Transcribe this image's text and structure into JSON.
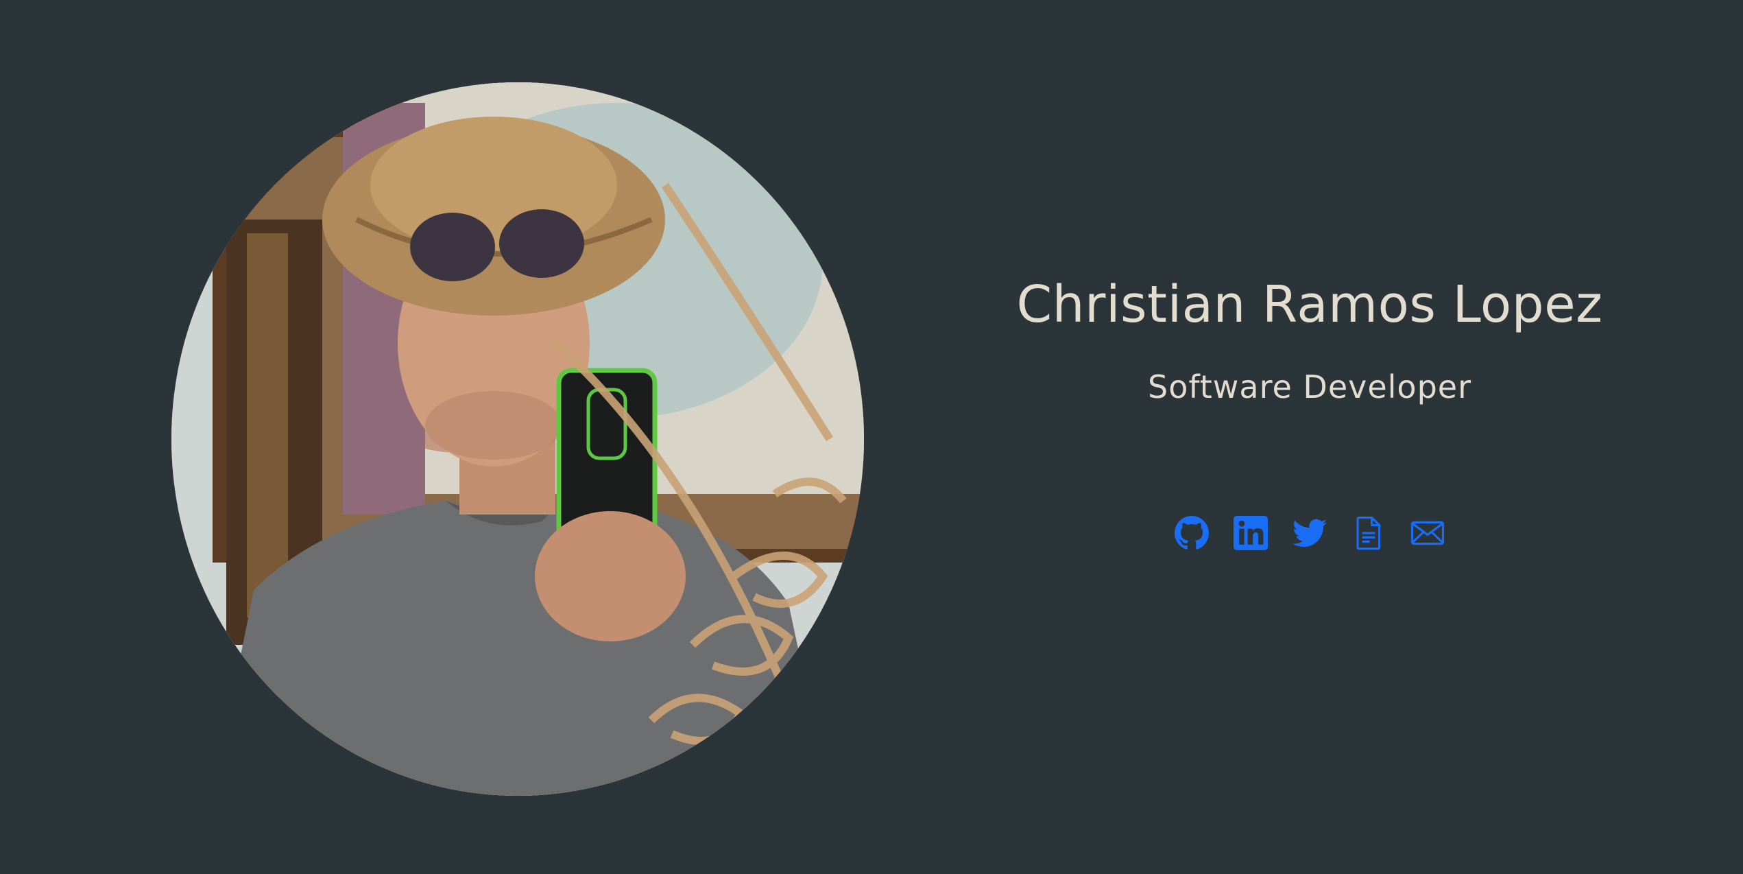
{
  "profile": {
    "name": "Christian Ramos Lopez",
    "title": "Software Developer",
    "photo_alt": "Christian Ramos Lopez"
  },
  "socials": [
    {
      "icon": "github-icon",
      "label": "GitHub"
    },
    {
      "icon": "linkedin-icon",
      "label": "LinkedIn"
    },
    {
      "icon": "twitter-icon",
      "label": "Twitter"
    },
    {
      "icon": "resume-icon",
      "label": "Resume"
    },
    {
      "icon": "email-icon",
      "label": "Email"
    }
  ],
  "colors": {
    "background": "#2b3438",
    "text": "#e3ddd0",
    "icon": "#1a6ef5"
  }
}
